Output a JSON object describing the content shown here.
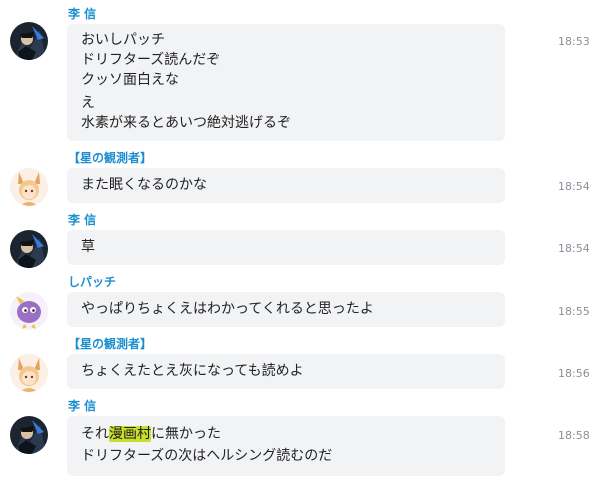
{
  "messages": [
    {
      "author": "李 信",
      "avatar_icon": "dark-armored-character-avatar",
      "lines": [
        "おいしパッチ",
        "ドリフターズ読んだぞ",
        "クッソ面白えな",
        "え",
        "水素が来るとあいつ絶対逃げるぞ"
      ],
      "time": "18:53"
    },
    {
      "author": "【星の観測者】",
      "avatar_icon": "blonde-fox-ear-girl-avatar",
      "lines": [
        "また眠くなるのかな"
      ],
      "time": "18:54"
    },
    {
      "author": "李 信",
      "avatar_icon": "dark-armored-character-avatar",
      "lines": [
        "草"
      ],
      "time": "18:54"
    },
    {
      "author": "しパッチ",
      "avatar_icon": "purple-round-creature-avatar",
      "lines": [
        "やっぱりちょくえはわかってくれると思ったよ"
      ],
      "time": "18:55"
    },
    {
      "author": "【星の観測者】",
      "avatar_icon": "blonde-fox-ear-girl-avatar",
      "lines": [
        "ちょくえたとえ灰になっても読めよ"
      ],
      "time": "18:56"
    },
    {
      "author": "李 信",
      "avatar_icon": "dark-armored-character-avatar",
      "lines_rich": {
        "pre": "それ",
        "highlight": "漫画村",
        "post": "に無かった"
      },
      "lines": [
        "ドリフターズの次はヘルシング読むのだ"
      ],
      "time": "18:58"
    }
  ],
  "colors": {
    "author": "#1d8fd0",
    "bubble": "#f2f3f5",
    "text": "#222222",
    "time": "#8a8f98",
    "highlight": "#c8de2a"
  }
}
